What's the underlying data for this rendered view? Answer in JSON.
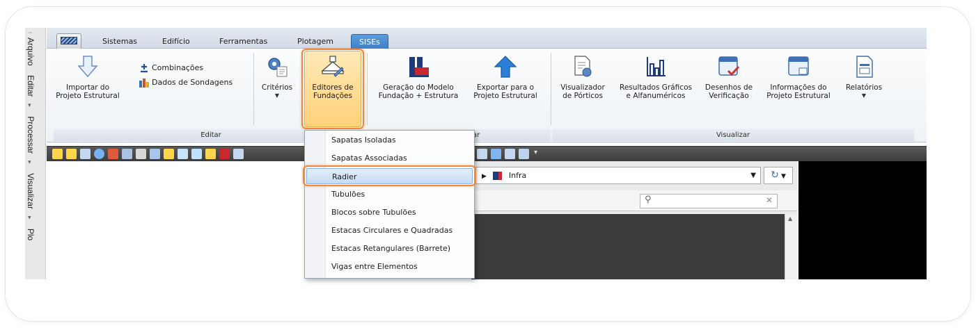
{
  "side_menu": [
    "Arquivo",
    "Editar",
    "Processar",
    "Visualizar",
    "Plo"
  ],
  "tabs": [
    "Sistemas",
    "Edifício",
    "Ferramentas",
    "Plotagem",
    "SISEs"
  ],
  "active_tab": "SISEs",
  "ribbon": {
    "import_label": "Importar do\nProjeto Estrutural",
    "combinacoes_label": "Combinações",
    "sondagens_label": "Dados de Sondagens",
    "criterios_label": "Critérios",
    "editores_label": "Editores de\nFundações",
    "geracao_label": "Geração do Modelo\nFundação + Estrutura",
    "exportar_label": "Exportar para o\nProjeto Estrutural",
    "visualizador_label": "Visualizador\nde Pórticos",
    "resultados_label": "Resultados Gráficos\ne Alfanuméricos",
    "desenhos_label": "Desenhos de\nVerificação",
    "informacoes_label": "Informações do\nProjeto Estrutural",
    "relatorios_label": "Relatórios",
    "group_editar": "Editar",
    "group_exportar_partial": "ar",
    "group_visualizar": "Visualizar"
  },
  "path": {
    "current": "Infra"
  },
  "dropdown_menu": {
    "items": [
      "Sapatas Isoladas",
      "Sapatas Associadas",
      "Radier",
      "Tubulões",
      "Blocos sobre Tubulões",
      "Estacas Circulares e Quadradas",
      "Estacas Retangulares (Barrete)",
      "Vigas entre Elementos"
    ],
    "selected": "Radier"
  },
  "colors": {
    "accent": "#3f7fc6",
    "highlight_outline": "#f0893a",
    "menu_selected": "#c6dcf3"
  }
}
